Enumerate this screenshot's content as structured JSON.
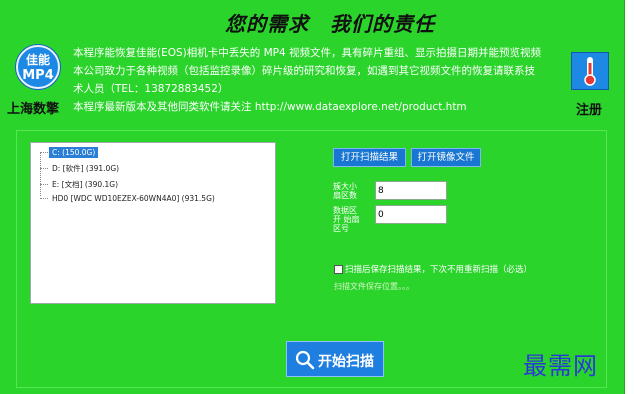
{
  "header": {
    "slogan": "您的需求　我们的责任",
    "logo_line1": "佳能",
    "logo_line2": "MP4",
    "brand": "上海数擎",
    "description_lines": [
      "本程序能恢复佳能(EOS)相机卡中丢失的 MP4 视频文件，具有碎片重组、显示拍摄日期并能预览视频",
      "本公司致力于各种视频（包括监控录像）碎片级的研究和恢复，如遇到其它视频文件的恢复请联系技",
      "术人员（TEL：13872883452）",
      "本程序最新版本及其他同类软件请关注 http://www.dataexplore.net/product.htm"
    ],
    "register_label": "注册",
    "register_icon": "thermometer-icon"
  },
  "drives": [
    {
      "label": "C:  (150.0G)",
      "selected": true
    },
    {
      "label": "D:  [软件]  (391.0G)",
      "selected": false
    },
    {
      "label": "E:  [文档]  (390.1G)",
      "selected": false
    },
    {
      "label": "HD0   [WDC WD10EZEX-60WN4A0]  (931.5G)",
      "selected": false
    }
  ],
  "buttons": {
    "open_scan_result": "打开扫描结果",
    "open_image_file": "打开镜像文件",
    "start_scan": "开始扫描"
  },
  "fields": {
    "max_cluster_label": "簇大小 扇区数",
    "max_cluster_value": "8",
    "data_start_label": "数据区开 始扇区号",
    "data_start_value": "0"
  },
  "options": {
    "save_checkbox_label": "扫描后保存扫描结果，下次不用重新扫描（必选）",
    "save_checkbox_checked": false,
    "save_path_label": "扫描文件保存位置。。。"
  },
  "watermark": "最需网",
  "colors": {
    "background": "#2ad42a",
    "button": "#1976d2",
    "selection": "#2a7ed6"
  }
}
